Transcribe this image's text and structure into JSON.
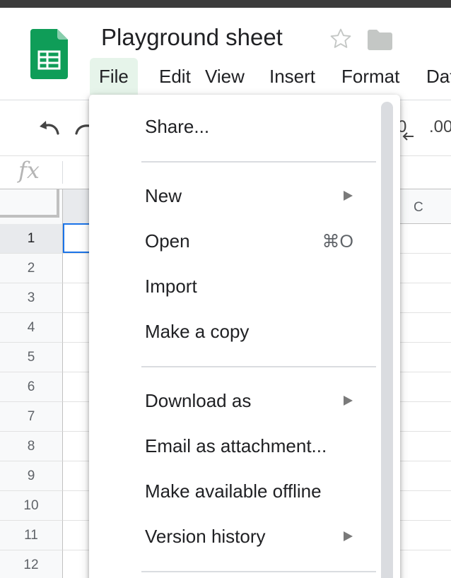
{
  "document": {
    "title": "Playground sheet"
  },
  "menubar": {
    "items": [
      {
        "label": "File",
        "active": true
      },
      {
        "label": "Edit"
      },
      {
        "label": "View"
      },
      {
        "label": "Insert"
      },
      {
        "label": "Format"
      },
      {
        "label": "Dat"
      }
    ]
  },
  "toolbar": {
    "partial_text_1": "0",
    "partial_text_2": ".00"
  },
  "formula_bar": {
    "fx_label": "fx"
  },
  "grid": {
    "column_headers": [
      "C"
    ],
    "row_numbers": [
      "1",
      "2",
      "3",
      "4",
      "5",
      "6",
      "7",
      "8",
      "9",
      "10",
      "11",
      "12"
    ],
    "selected_row": "1"
  },
  "file_menu": {
    "items": [
      {
        "label": "Share..."
      },
      {
        "label": "New",
        "submenu": true
      },
      {
        "label": "Open",
        "shortcut": "⌘O"
      },
      {
        "label": "Import"
      },
      {
        "label": "Make a copy"
      },
      {
        "label": "Download as",
        "submenu": true
      },
      {
        "label": "Email as attachment..."
      },
      {
        "label": "Make available offline"
      },
      {
        "label": "Version history",
        "submenu": true
      }
    ]
  },
  "colors": {
    "sheets_green": "#0f9d58",
    "menu_active_bg": "#e6f4ea",
    "selection_blue": "#1a73e8"
  },
  "icons": [
    "sheets-logo-icon",
    "star-icon",
    "folder-icon",
    "undo-icon",
    "redo-icon",
    "submenu-arrow-icon"
  ]
}
